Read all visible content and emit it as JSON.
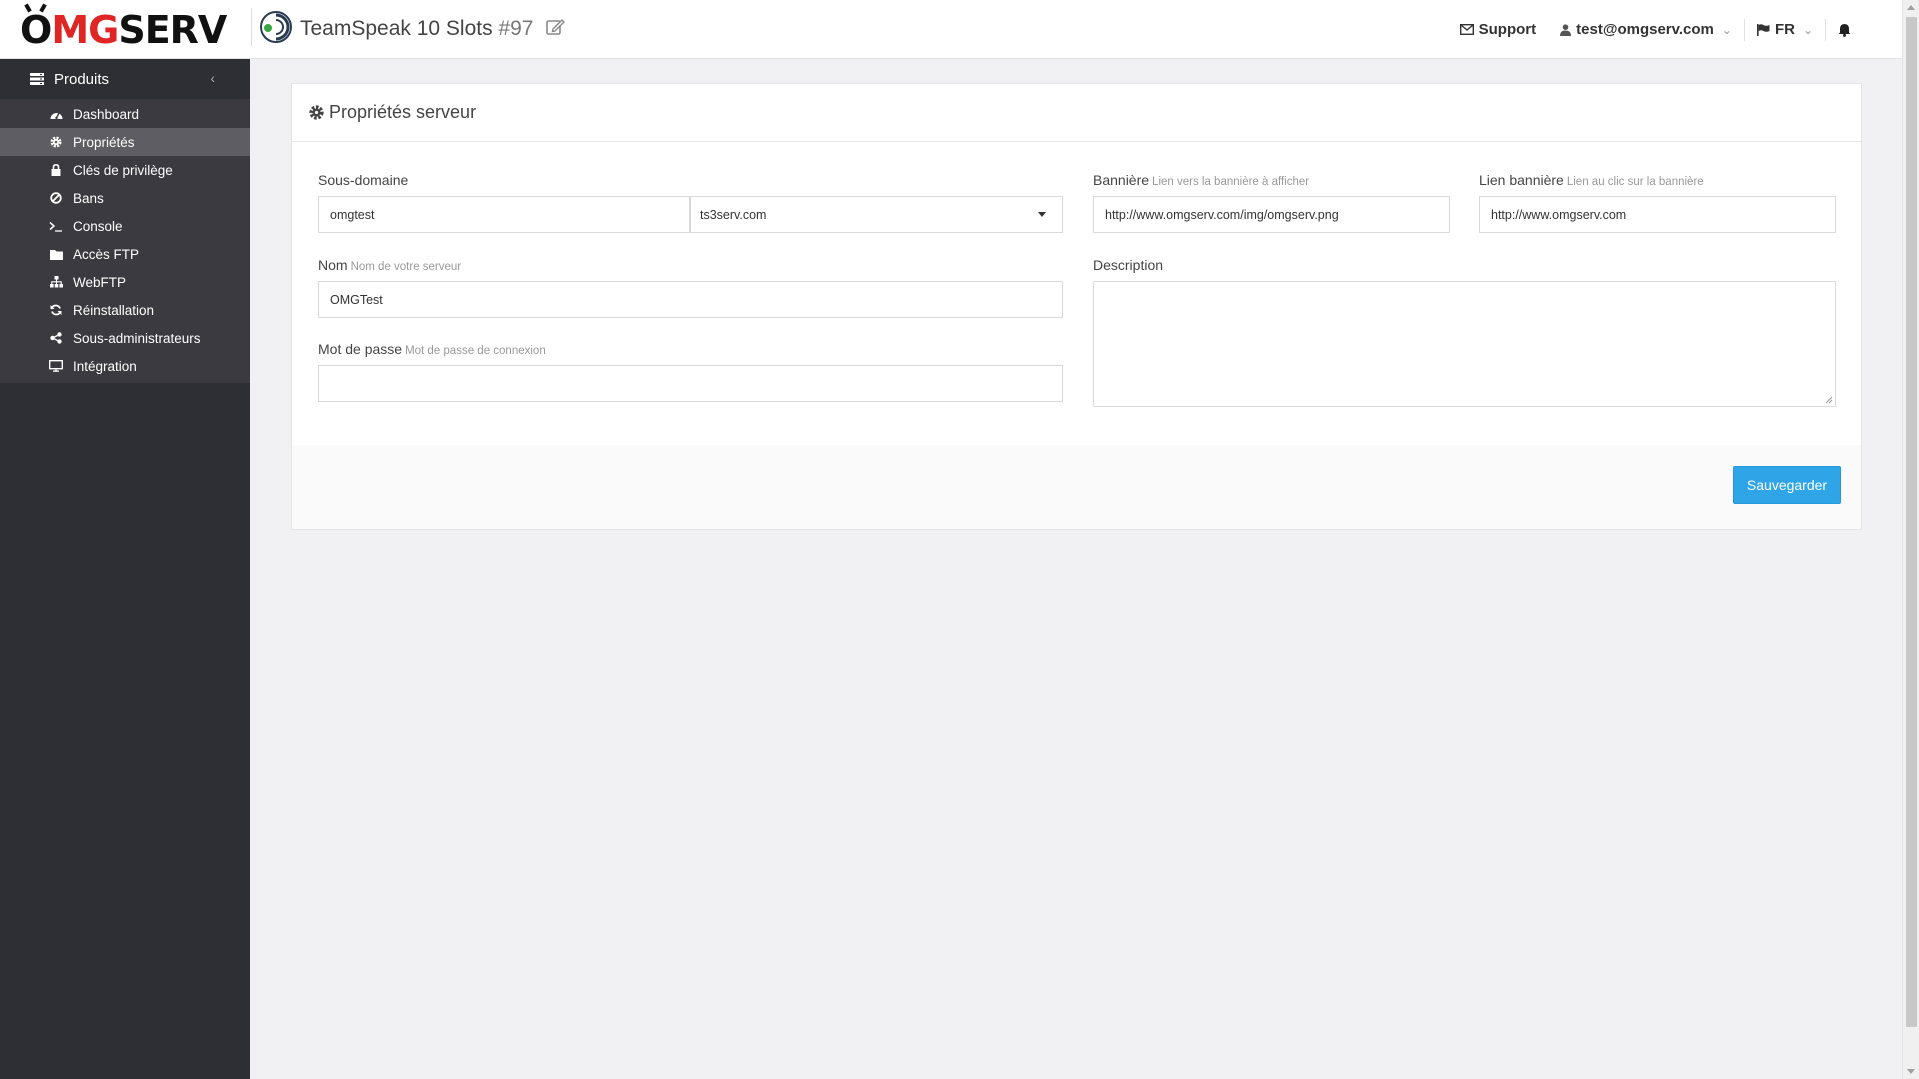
{
  "brand": {
    "logo_o": "O",
    "logo_mg": "MG",
    "logo_serv": "SERV"
  },
  "header": {
    "product_name": "TeamSpeak 10 Slots",
    "product_number": "#97",
    "support_label": "Support",
    "user_email": "test@omgserv.com",
    "language": "FR"
  },
  "sidebar": {
    "section_label": "Produits",
    "items": [
      {
        "label": "Dashboard",
        "icon": "dashboard-icon"
      },
      {
        "label": "Propriétés",
        "icon": "gear-icon",
        "active": true
      },
      {
        "label": "Clés de privilège",
        "icon": "lock-icon"
      },
      {
        "label": "Bans",
        "icon": "ban-icon"
      },
      {
        "label": "Console",
        "icon": "terminal-icon"
      },
      {
        "label": "Accès FTP",
        "icon": "folder-icon"
      },
      {
        "label": "WebFTP",
        "icon": "sitemap-icon"
      },
      {
        "label": "Réinstallation",
        "icon": "refresh-icon"
      },
      {
        "label": "Sous-administrateurs",
        "icon": "share-icon"
      },
      {
        "label": "Intégration",
        "icon": "desktop-icon"
      }
    ]
  },
  "panel": {
    "title": "Propriétés serveur",
    "subdomain": {
      "label": "Sous-domaine",
      "value": "omgtest",
      "domain_selected": "ts3serv.com"
    },
    "name": {
      "label": "Nom",
      "hint": "Nom de votre serveur",
      "value": "OMGTest"
    },
    "password": {
      "label": "Mot de passe",
      "hint": "Mot de passe de connexion",
      "value": ""
    },
    "banner": {
      "label": "Bannière",
      "hint": "Lien vers la bannière à afficher",
      "value": "http://www.omgserv.com/img/omgserv.png"
    },
    "banner_link": {
      "label": "Lien bannière",
      "hint": "Lien au clic sur la bannière",
      "value": "http://www.omgserv.com"
    },
    "description": {
      "label": "Description",
      "value": ""
    },
    "save_label": "Sauvegarder"
  },
  "colors": {
    "accent": "#2fa4e7",
    "brand_red": "#e02525",
    "sidebar_bg": "#2e2e35",
    "sidebar_active": "#5d5d63"
  }
}
